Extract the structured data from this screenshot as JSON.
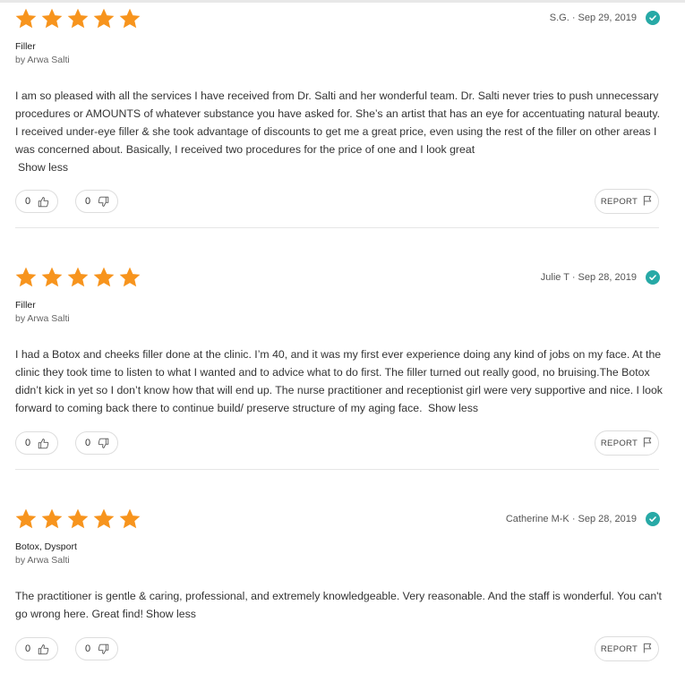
{
  "colors": {
    "star": "#f7941d",
    "verified": "#27a9a6",
    "divider": "#e6e6e6"
  },
  "reviews": [
    {
      "rating": 5,
      "author": "S.G.",
      "date": "Sep 29, 2019",
      "meta": "S.G. · Sep 29, 2019",
      "verified": true,
      "procedure": "Filler",
      "byline": "by Arwa Salti",
      "text": "I am so pleased with all the services I have received from Dr. Salti and her wonderful team. Dr. Salti never tries to push unnecessary procedures or AMOUNTS of whatever substance you have asked for. She’s an artist that has an eye for accentuating natural beauty. I received under-eye filler & she took advantage of discounts to get me a great price, even using the rest of the filler on other areas I was concerned about. Basically, I received two procedures for the price of one and I look great",
      "show_less": "Show less",
      "upvotes": "0",
      "downvotes": "0",
      "report": "REPORT"
    },
    {
      "rating": 5,
      "author": "Julie T",
      "date": "Sep 28, 2019",
      "meta": "Julie T · Sep 28, 2019",
      "verified": true,
      "procedure": "Filler",
      "byline": "by Arwa Salti",
      "text": "I had a Botox and cheeks filler done at the clinic. I’m 40, and it was my first ever experience doing any kind of jobs on my face. At the clinic they took time to listen to what I wanted and to advice what to do first. The filler turned out really good, no bruising.The Botox didn’t kick in yet so I don’t know how that will end up. The nurse practitioner and receptionist girl were very supportive and nice. I look forward to coming back there to continue build/ preserve structure of my aging face. ",
      "show_less": "Show less",
      "upvotes": "0",
      "downvotes": "0",
      "report": "REPORT"
    },
    {
      "rating": 5,
      "author": "Catherine M-K",
      "date": "Sep 28, 2019",
      "meta": "Catherine M-K · Sep 28, 2019",
      "verified": true,
      "procedure": "Botox, Dysport",
      "byline": "by Arwa Salti",
      "text": "The practitioner is gentle & caring, professional, and extremely knowledgeable. Very reasonable. And the staff is wonderful. You can't go wrong here. Great find!",
      "show_less": "Show less",
      "upvotes": "0",
      "downvotes": "0",
      "report": "REPORT"
    }
  ]
}
